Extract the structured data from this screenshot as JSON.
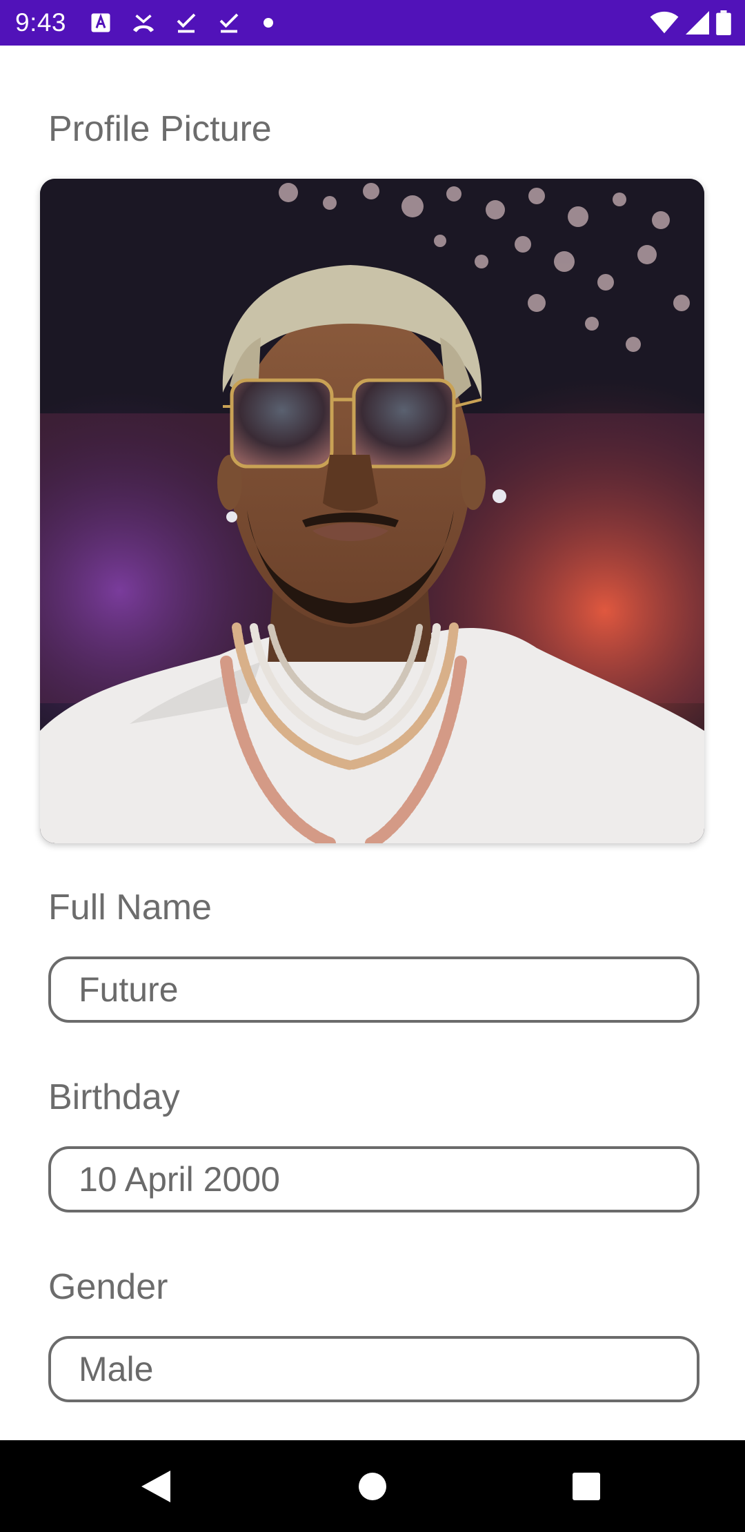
{
  "status_bar": {
    "time": "9:43",
    "background_color": "#5112b9",
    "notification_icons": [
      "text-a-icon",
      "missed-call-icon",
      "checkmark-download-icon",
      "checkmark-download-icon",
      "dot-icon"
    ],
    "system_icons": [
      "wifi-icon",
      "cell-signal-icon",
      "battery-icon"
    ]
  },
  "profile": {
    "picture_label": "Profile Picture",
    "name_label": "Full Name",
    "name_value": "Future",
    "birthday_label": "Birthday",
    "birthday_value": "10 April 2000",
    "gender_label": "Gender",
    "gender_value": "Male"
  },
  "nav_bar": {
    "buttons": [
      "back-icon",
      "home-icon",
      "recents-icon"
    ]
  }
}
